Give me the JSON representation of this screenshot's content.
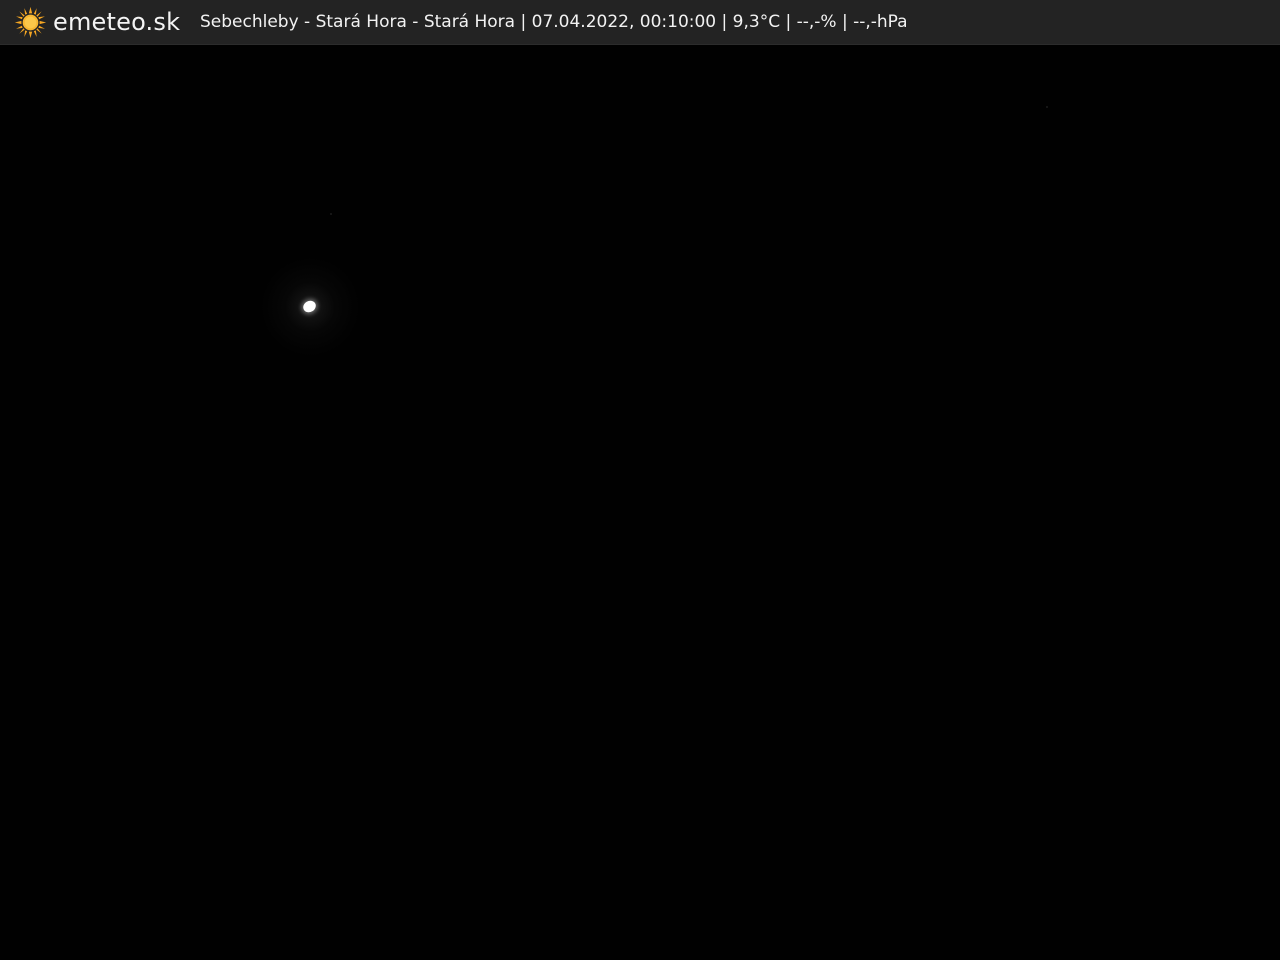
{
  "header": {
    "brand": "emeteo.sk",
    "caption": "Sebechleby - Stará Hora - Stará Hora | 07.04.2022, 00:10:00 | 9,3°C | --,-% | --,-hPa",
    "logo_icon": "sun-icon",
    "background_color": "#232323",
    "text_color": "#f4f4f4",
    "sun_color": "#f5a623"
  },
  "scene": {
    "background_color": "#010101",
    "subject": "moon-icon"
  }
}
